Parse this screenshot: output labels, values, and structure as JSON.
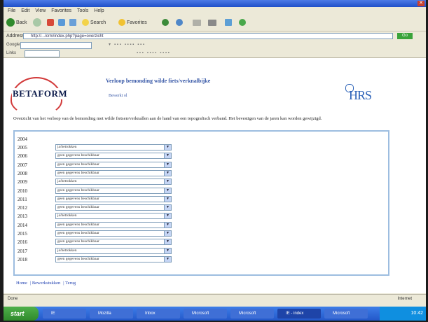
{
  "browser": {
    "title": "",
    "menu": [
      "File",
      "Edit",
      "View",
      "Favorites",
      "Tools",
      "Help"
    ],
    "toolbar": [
      "Back",
      "Search",
      "Favorites"
    ],
    "address_label": "Address",
    "address_value": "http://.../crm/index.php?page=overzicht",
    "go_label": "Go",
    "google_label": "Google",
    "links_label": "Links"
  },
  "page": {
    "logo_text": "BETAFORM",
    "title": "Verloop bemonding wilde fiets/verknalbijke",
    "subtitle": "Bewerkt ol",
    "hrs_logo": "HRS",
    "intro": "Overzicht van het verloop van de bemonding met wilde fietsen/verknallen aan de hand van een topografisch verband. Het bevestigen van de jaren kan worden gewijzigd.",
    "first_year": "2004",
    "years": [
      {
        "year": "2005",
        "value": "ja/betrokken"
      },
      {
        "year": "2006",
        "value": "geen gegevens beschikbaar"
      },
      {
        "year": "2007",
        "value": "geen gegevens beschikbaar"
      },
      {
        "year": "2008",
        "value": "geen gegevens beschikbaar"
      },
      {
        "year": "2009",
        "value": "ja/betrokken"
      },
      {
        "year": "2010",
        "value": "geen gegevens beschikbaar"
      },
      {
        "year": "2011",
        "value": "geen gegevens beschikbaar"
      },
      {
        "year": "2012",
        "value": "geen gegevens beschikbaar"
      },
      {
        "year": "2013",
        "value": "ja/betrokken"
      },
      {
        "year": "2014",
        "value": "geen gegevens beschikbaar"
      },
      {
        "year": "2015",
        "value": "geen gegevens beschikbaar"
      },
      {
        "year": "2016",
        "value": "geen gegevens beschikbaar"
      },
      {
        "year": "2017",
        "value": "ja/betrokken"
      },
      {
        "year": "2018",
        "value": "geen gegevens beschikbaar"
      }
    ],
    "footer_links": [
      "Home",
      "Bewerkstukken",
      "Terug"
    ]
  },
  "statusbar": {
    "left": "Done",
    "zone": "Internet"
  },
  "taskbar": {
    "start": "start",
    "tasks": [
      "IE",
      "Mozilla",
      "Inbox",
      "Microsoft",
      "Microsoft",
      "IE - index",
      "Microsoft"
    ],
    "clock": "10:42"
  }
}
